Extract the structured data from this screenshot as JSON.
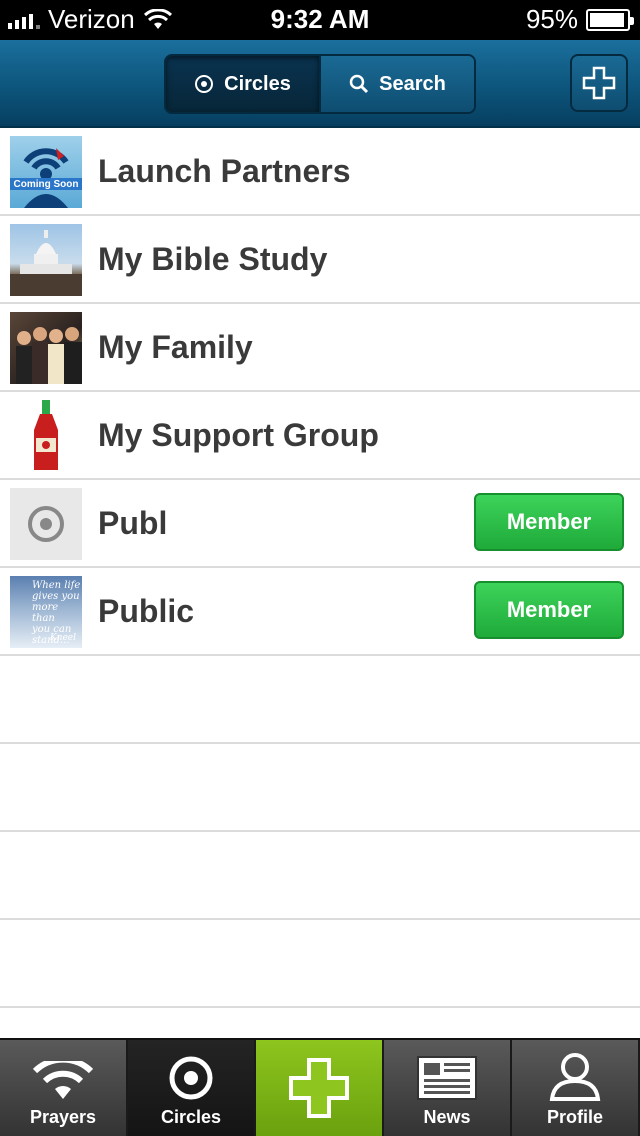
{
  "status_bar": {
    "carrier": "Verizon",
    "time": "9:32 AM",
    "battery": "95%",
    "battery_level": 0.95
  },
  "nav": {
    "segments": [
      {
        "label": "Circles",
        "icon": "target-icon",
        "active": true
      },
      {
        "label": "Search",
        "icon": "search-icon",
        "active": false
      }
    ],
    "add_icon": "plus-icon"
  },
  "circles": [
    {
      "name": "Launch Partners",
      "thumbnail": "coming-soon-logo",
      "member": false,
      "thumb_text": "Coming Soon"
    },
    {
      "name": "My Bible Study",
      "thumbnail": "capitol-photo",
      "member": false
    },
    {
      "name": "My Family",
      "thumbnail": "family-photo",
      "member": false
    },
    {
      "name": "My Support Group",
      "thumbnail": "hot-sauce-bottle-photo",
      "member": false
    },
    {
      "name": "Publ",
      "thumbnail": "default-target-icon",
      "member": true,
      "member_label": "Member"
    },
    {
      "name": "Public",
      "thumbnail": "quote-photo",
      "member": true,
      "member_label": "Member",
      "thumb_text": [
        "When life",
        "gives you",
        "more than",
        "you can",
        "stand...",
        "Kneel"
      ]
    }
  ],
  "tab_bar": {
    "tabs": [
      {
        "label": "Prayers",
        "icon": "wifi-signal-icon",
        "selected": false
      },
      {
        "label": "Circles",
        "icon": "target-icon",
        "selected": true
      },
      {
        "label": "",
        "icon": "plus-icon",
        "selected": false
      },
      {
        "label": "News",
        "icon": "newspaper-icon",
        "selected": false
      },
      {
        "label": "Profile",
        "icon": "person-icon",
        "selected": false
      }
    ]
  },
  "colors": {
    "nav_blue": "#0f5a82",
    "member_green": "#2fc04a",
    "add_tab_green": "#7bb416"
  }
}
